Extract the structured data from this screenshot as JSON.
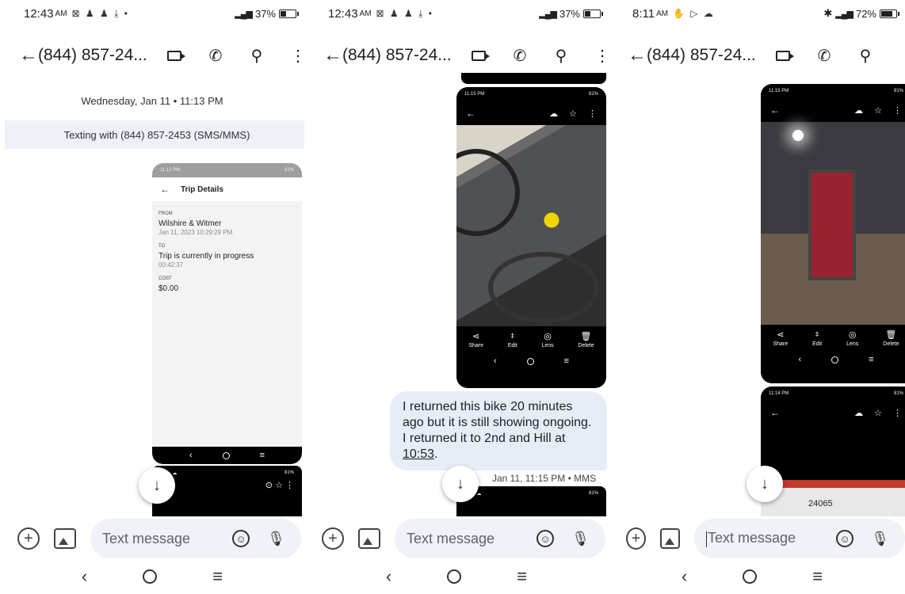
{
  "panes": [
    {
      "status": {
        "time": "12:43",
        "ampm": "AM",
        "notifications": "⊠ ♟ ♟ ⤓ •",
        "battery": "37%",
        "battery_level": 0.37
      },
      "header": {
        "contact": "(844) 857-24..."
      },
      "date_header": "Wednesday, Jan 11 • 11:13 PM",
      "texting_banner": "Texting with (844) 857-2453 (SMS/MMS)",
      "screenshot": {
        "status_time": "11:12 PM",
        "status_right": "81%",
        "title": "Trip Details",
        "from_label": "FROM",
        "from_value": "Wilshire & Witmer",
        "from_time": "Jan 11, 2023 10:29:29 PM",
        "to_label": "TO",
        "to_value": "Trip is currently in progress",
        "to_time": "00:42:37",
        "cost_label": "COST",
        "cost_value": "$0.00"
      },
      "composer": {
        "placeholder": "Text message"
      }
    },
    {
      "status": {
        "time": "12:43",
        "ampm": "AM",
        "notifications": "⊠ ♟ ♟ ⤓ •",
        "battery": "37%",
        "battery_level": 0.37
      },
      "header": {
        "contact": "(844) 857-24..."
      },
      "photo_tools": [
        "Share",
        "Edit",
        "Lens",
        "Delete"
      ],
      "message": {
        "text_main": "I returned this bike 20 minutes ago but it is still showing ongoing. I returned it to 2nd and Hill at ",
        "text_link": "10:53",
        "text_end": "."
      },
      "message_meta": "Jan 11, 11:15 PM • MMS",
      "composer": {
        "placeholder": "Text message"
      }
    },
    {
      "status": {
        "time": "8:11",
        "ampm": "AM",
        "battery": "72%",
        "battery_level": 0.72
      },
      "header": {
        "contact": "(844) 857-24..."
      },
      "photo_tools": [
        "Share",
        "Edit",
        "Lens",
        "Delete"
      ],
      "bike_number": "24065",
      "composer": {
        "placeholder": "Text message"
      }
    }
  ]
}
